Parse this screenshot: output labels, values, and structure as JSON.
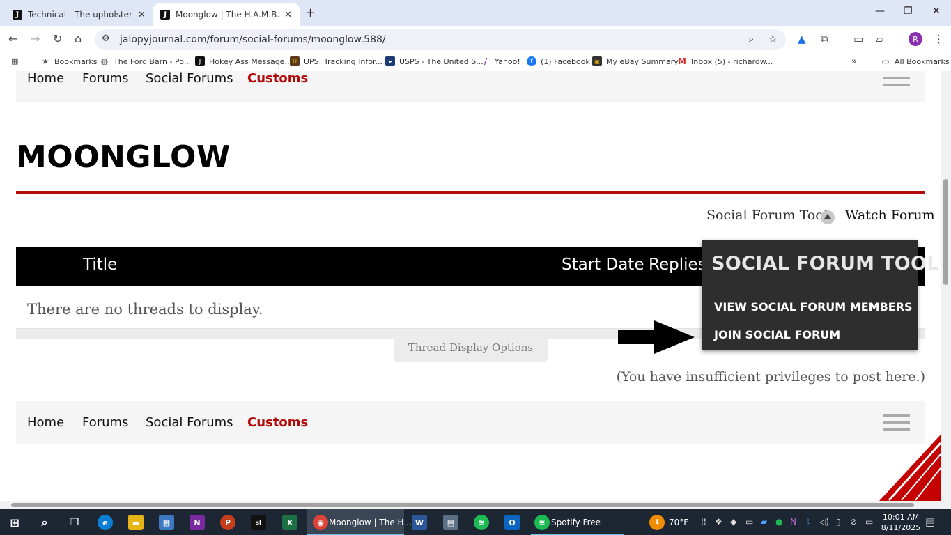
{
  "browser": {
    "tabs": [
      {
        "title": "Technical - The upholstery thread",
        "favicon": "J"
      },
      {
        "title": "Moonglow | The H.A.M.B.",
        "favicon": "J"
      }
    ],
    "url": "jalopyjournal.com/forum/social-forums/moonglow.588/",
    "profile_initial": "R",
    "bookmarks": [
      {
        "label": "Bookmarks",
        "icon": "star-icon"
      },
      {
        "label": "The Ford Barn - Po...",
        "icon": "globe-icon"
      },
      {
        "label": "Hokey Ass Message...",
        "icon": "J"
      },
      {
        "label": "UPS: Tracking Infor...",
        "icon": "ups-icon"
      },
      {
        "label": "USPS - The United S...",
        "icon": "usps-icon"
      },
      {
        "label": "Yahoo!",
        "icon": "yahoo-icon"
      },
      {
        "label": "(1) Facebook",
        "icon": "facebook-icon"
      },
      {
        "label": "My eBay Summary",
        "icon": "ebay-icon"
      },
      {
        "label": "Inbox (5) - richardw...",
        "icon": "gmail-icon"
      }
    ],
    "all_bookmarks": "All Bookmarks"
  },
  "nav": {
    "home": "Home",
    "forums": "Forums",
    "social_forums": "Social Forums",
    "customs": "Customs"
  },
  "page": {
    "title": "MOONGLOW",
    "tools_link": "Social Forum Tools",
    "watch_link": "Watch Forum",
    "columns": {
      "title": "Title",
      "start_date": "Start Date",
      "replies": "Replies"
    },
    "empty_message": "There are no threads to display.",
    "thread_options": "Thread Display Options",
    "privileges": "(You have insufficient privileges to post here.)"
  },
  "popup": {
    "heading": "SOCIAL FORUM TOOLS",
    "items": [
      "VIEW SOCIAL FORUM MEMBERS",
      "JOIN SOCIAL FORUM"
    ]
  },
  "taskbar": {
    "chrome_label": "Moonglow | The H...",
    "spotify_label": "Spotify Free",
    "weather": "70°F",
    "time": "10:01 AM",
    "date": "8/11/2025",
    "weather_badge": "1"
  },
  "colors": {
    "accent_red": "#b30a0a",
    "header_black": "#000000",
    "popup_bg": "#2e2e2e"
  }
}
